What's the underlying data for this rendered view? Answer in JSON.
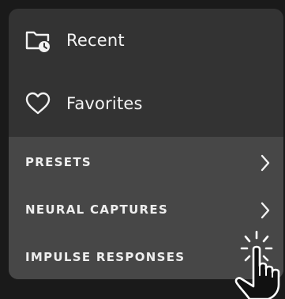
{
  "menu": {
    "top_items": [
      {
        "label": "Recent",
        "icon": "folder-clock-icon"
      },
      {
        "label": "Favorites",
        "icon": "heart-icon"
      }
    ],
    "sub_items": [
      {
        "label": "PRESETS",
        "icon": "chevron-right-icon"
      },
      {
        "label": "NEURAL CAPTURES",
        "icon": "chevron-right-icon"
      },
      {
        "label": "IMPULSE RESPONSES",
        "icon": "tap-hand-icon"
      }
    ]
  },
  "colors": {
    "background": "#1a1a1a",
    "panel": "#333333",
    "sub_panel": "#474747",
    "text": "#f2f2f2"
  }
}
